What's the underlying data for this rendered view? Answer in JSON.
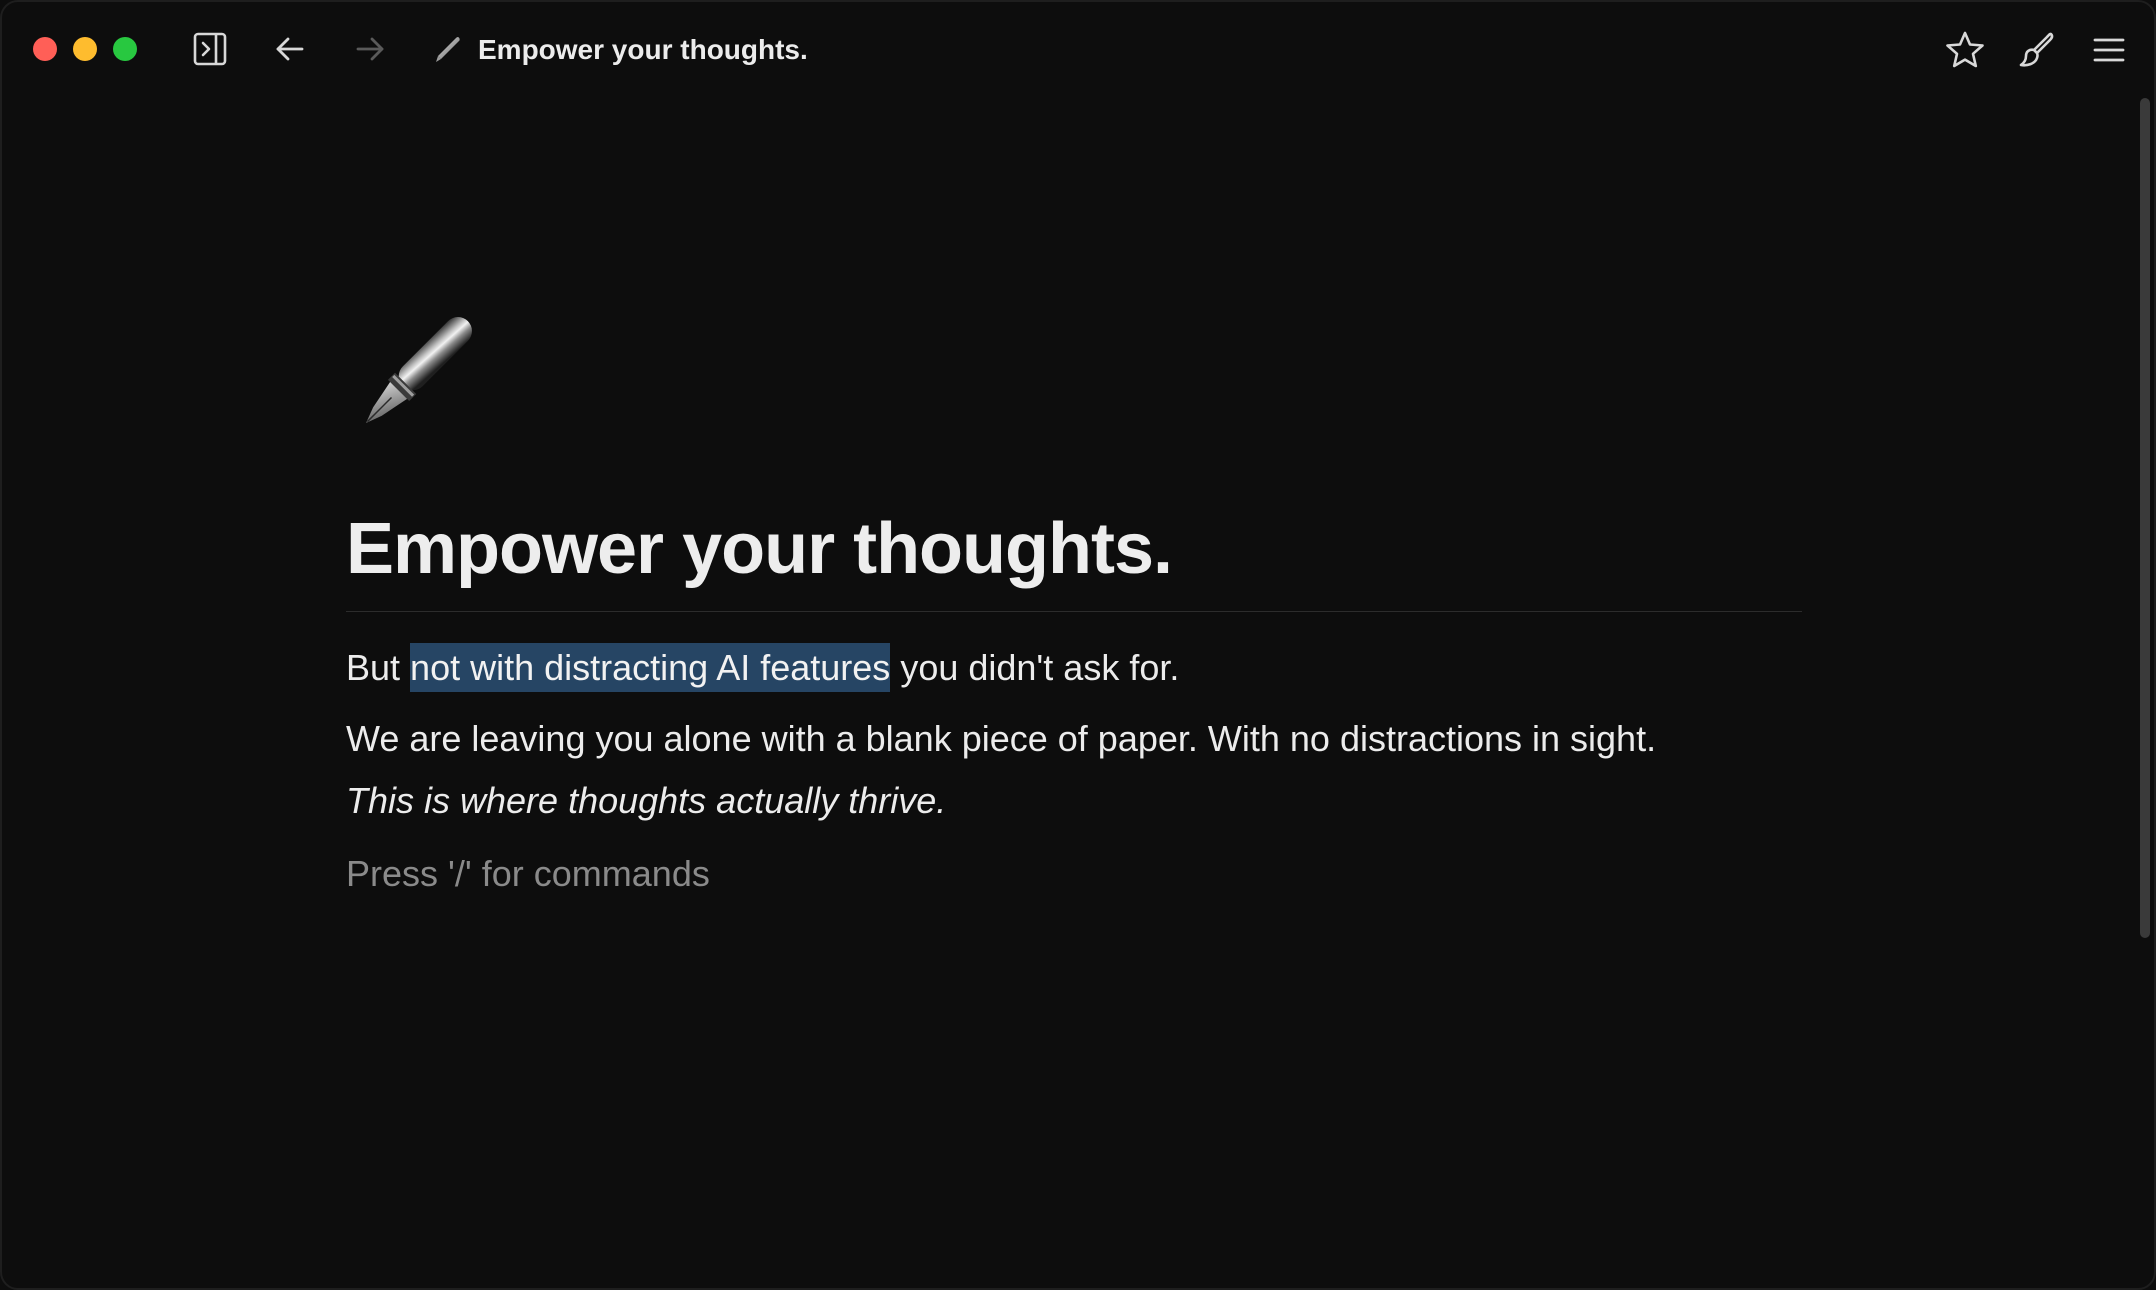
{
  "window": {
    "traffic_lights": {
      "close_color": "#ff5f57",
      "minimize_color": "#febc2e",
      "maximize_color": "#28c840"
    }
  },
  "toolbar": {
    "left_icons": [
      "sidebar-toggle-icon",
      "arrow-left-icon",
      "arrow-right-icon"
    ],
    "right_icons": [
      "star-icon",
      "brush-icon",
      "hamburger-menu-icon"
    ],
    "doc_title": "Empower your thoughts.",
    "doc_title_icon": "fountain-pen-icon"
  },
  "document": {
    "icon": "fountain-pen-icon",
    "title": "Empower your thoughts.",
    "paragraph1": {
      "before": "But ",
      "highlighted": "not with distracting AI features",
      "after": " you didn't ask for."
    },
    "paragraph2": "We are leaving you alone with a blank piece of paper. With no distractions in sight.",
    "paragraph3": "This is where thoughts actually thrive.",
    "placeholder": "Press '/' for commands"
  },
  "colors": {
    "background": "#0d0d0d",
    "text": "#ececec",
    "highlight": "#264564",
    "placeholder": "#8a8a8a"
  }
}
